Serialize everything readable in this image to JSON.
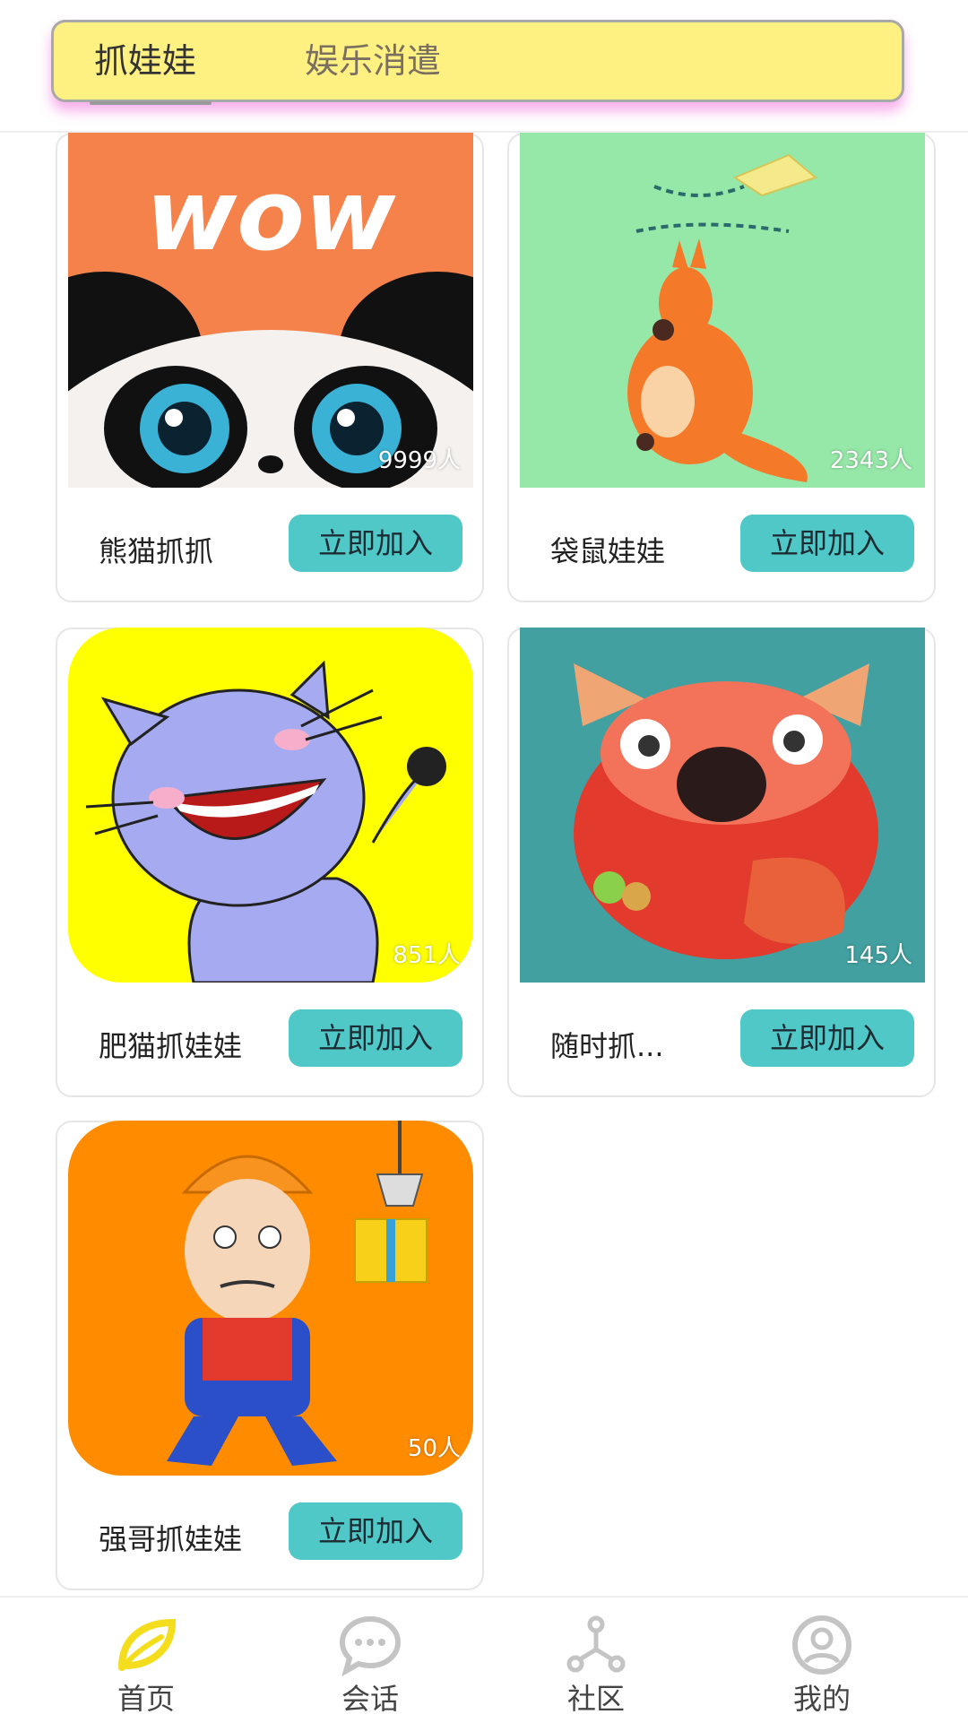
{
  "tabs": [
    {
      "label": "抓娃娃",
      "active": true
    },
    {
      "label": "娱乐消遣",
      "active": false
    }
  ],
  "cards": [
    {
      "title": "熊猫抓抓",
      "count": "9999人",
      "button": "立即加入",
      "image": "panda-wow-image"
    },
    {
      "title": "袋鼠娃娃",
      "count": "2343人",
      "button": "立即加入",
      "image": "kangaroo-kite-image"
    },
    {
      "title": "肥猫抓娃娃",
      "count": "851人",
      "button": "立即加入",
      "image": "laughing-cat-image"
    },
    {
      "title": "随时抓...",
      "count": "145人",
      "button": "立即加入",
      "image": "red-fox-image"
    },
    {
      "title": "强哥抓娃娃",
      "count": "50人",
      "button": "立即加入",
      "image": "man-with-gift-image"
    }
  ],
  "nav": [
    {
      "label": "首页",
      "icon": "home-leaf-icon",
      "active": true
    },
    {
      "label": "会话",
      "icon": "chat-bubble-icon",
      "active": false
    },
    {
      "label": "社区",
      "icon": "community-nodes-icon",
      "active": false
    },
    {
      "label": "我的",
      "icon": "profile-icon",
      "active": false
    }
  ],
  "colors": {
    "tab_bar_bg": "#fef182",
    "button_bg": "#4fc8c7",
    "active_nav": "#f3dd1c"
  }
}
